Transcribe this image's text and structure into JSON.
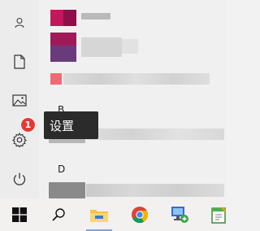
{
  "rail": {
    "items": [
      {
        "name": "user-icon"
      },
      {
        "name": "documents-icon"
      },
      {
        "name": "pictures-icon"
      },
      {
        "name": "settings-icon"
      },
      {
        "name": "power-icon"
      }
    ]
  },
  "app_list": {
    "sections": [
      "B",
      "D"
    ]
  },
  "tooltip": {
    "text": "设置"
  },
  "badge": {
    "text": "1"
  },
  "taskbar": {
    "items": [
      "windows-start-icon",
      "search-icon",
      "file-explorer-icon",
      "chrome-icon",
      "network-app-icon",
      "notepad-app-icon"
    ]
  },
  "colors": {
    "tooltip_bg": "#2b2b2b",
    "badge": "#e53935",
    "taskbar_bg": "#f3f0f0"
  }
}
